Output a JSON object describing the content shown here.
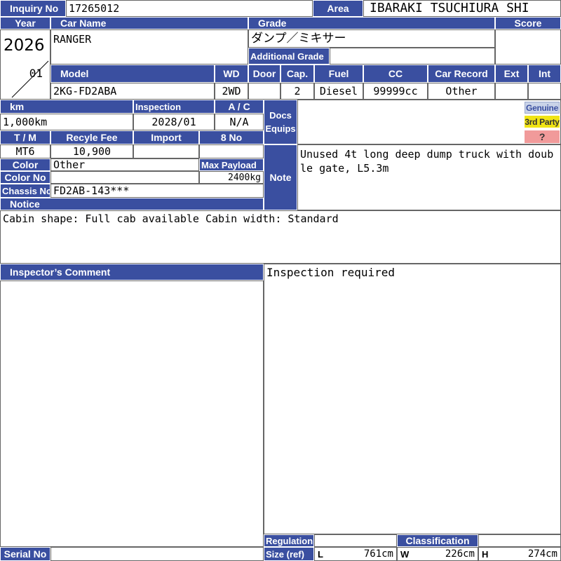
{
  "labels": {
    "inquiry_no": "Inquiry No",
    "area": "Area",
    "year": "Year",
    "car_name": "Car Name",
    "grade": "Grade",
    "score": "Score",
    "additional_grade": "Additional Grade",
    "model": "Model",
    "wd": "WD",
    "door": "Door",
    "cap": "Cap.",
    "fuel": "Fuel",
    "cc": "CC",
    "car_record": "Car Record",
    "ext": "Ext",
    "int": "Int",
    "km": "km",
    "inspection": "Inspection",
    "ac": "A / C",
    "docs_equips": "Docs Equips",
    "tm": "T / M",
    "recycle_fee": "Recyle Fee",
    "import": "Import",
    "eight_no": "8 No",
    "color": "Color",
    "max_payload": "Max Payload",
    "color_no": "Color No",
    "chassis_no": "Chassis No",
    "notice": "Notice",
    "note": "Note",
    "inspectors_comment": "Inspector’s Comment",
    "regulation": "Regulation",
    "size_ref": "Size (ref)",
    "classification": "Classification",
    "serial_no": "Serial No",
    "len_l": "L",
    "len_w": "W",
    "len_h": "H"
  },
  "values": {
    "inquiry_no": "17265012",
    "area": "IBARAKI TSUCHIURA SHI",
    "year": "2026",
    "month": "01",
    "car_name": "RANGER",
    "grade": "ダンプ／ミキサー",
    "additional_grade": "",
    "score": "",
    "model": "2KG-FD2ABA",
    "wd": "2WD",
    "door": "",
    "cap": "2",
    "fuel": "Diesel",
    "cc": "99999cc",
    "car_record": "Other",
    "ext": "",
    "int": "",
    "km": "1,000km",
    "inspection": "2028/01",
    "ac": "N/A",
    "tm": "MT6",
    "recycle_fee": "10,900",
    "import": "",
    "eight_no": "",
    "color": "Other",
    "max_payload": "2400kg",
    "color_no": "",
    "chassis_no": "FD2AB-143***",
    "note": "Unused 4t long deep dump truck with double gate, L5.3m",
    "notice": "Cabin shape: Full cab available Cabin width: Standard",
    "inspector_comment": "Inspection required",
    "regulation": "",
    "classification": "",
    "serial_no": "",
    "size_l": "761cm",
    "size_w": "226cm",
    "size_h": "274cm"
  },
  "badges": {
    "genuine": "Genuine",
    "third_party": "3rd Party",
    "unknown": "?"
  },
  "colors": {
    "header_blue": "#3a4fa0",
    "genuine_bg": "#c9d3e8",
    "third_party_bg": "#f0e414",
    "unknown_bg": "#f19a9a"
  }
}
